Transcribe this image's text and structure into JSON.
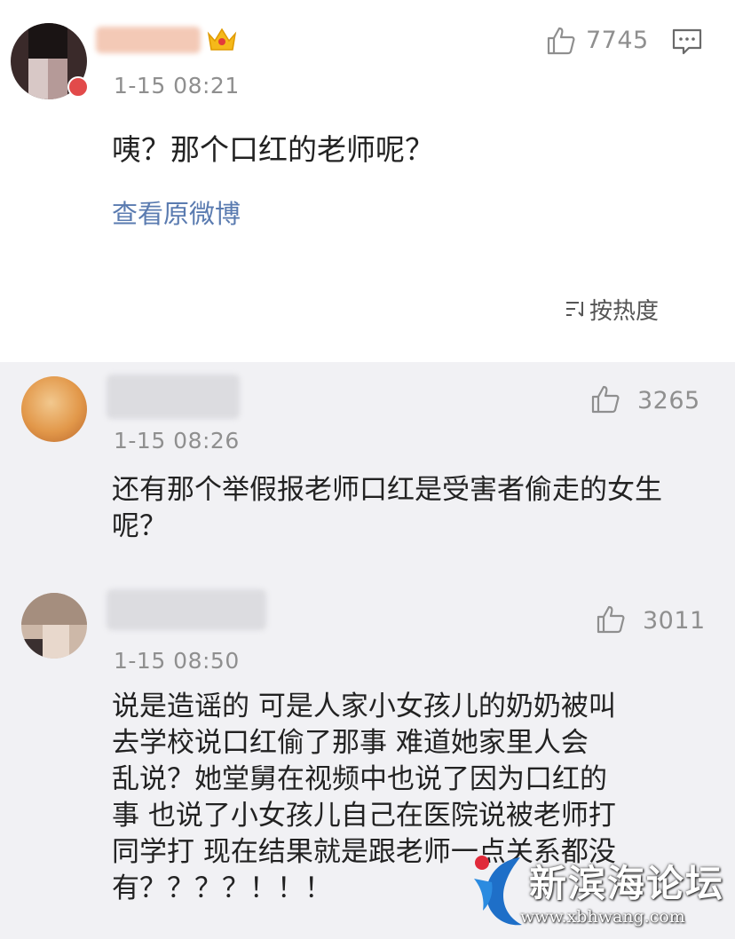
{
  "original_post": {
    "timestamp": "1-15 08:21",
    "likes": "7745",
    "text": "咦？那个口红的老师呢？",
    "view_original_label": "查看原微博",
    "sort_label": "按热度",
    "crown_icon": "crown-icon",
    "comment_icon": "comment-icon"
  },
  "comments": [
    {
      "timestamp": "1-15 08:26",
      "likes": "3265",
      "text_lines": [
        "还有那个举假报老师口红是受害者偷走的女生",
        "呢？"
      ]
    },
    {
      "timestamp": "1-15 08:50",
      "likes": "3011",
      "text_lines": [
        "说是造谣的 可是人家小女孩儿的奶奶被叫",
        "去学校说口红偷了那事 难道她家里人会",
        "乱说？她堂舅在视频中也说了因为口红的",
        "事 也说了小女孩儿自己在医院说被老师打",
        "同学打 现在结果就是跟老师一点关系都没",
        "有？？？？！！！"
      ]
    }
  ],
  "watermark": {
    "title": "新滨海论坛",
    "url": "www.xbhwang.com"
  },
  "colors": {
    "link": "#5a7bb0",
    "secondary_text": "#8f8f8f",
    "background": "#f1f1f4",
    "card": "#ffffff"
  }
}
